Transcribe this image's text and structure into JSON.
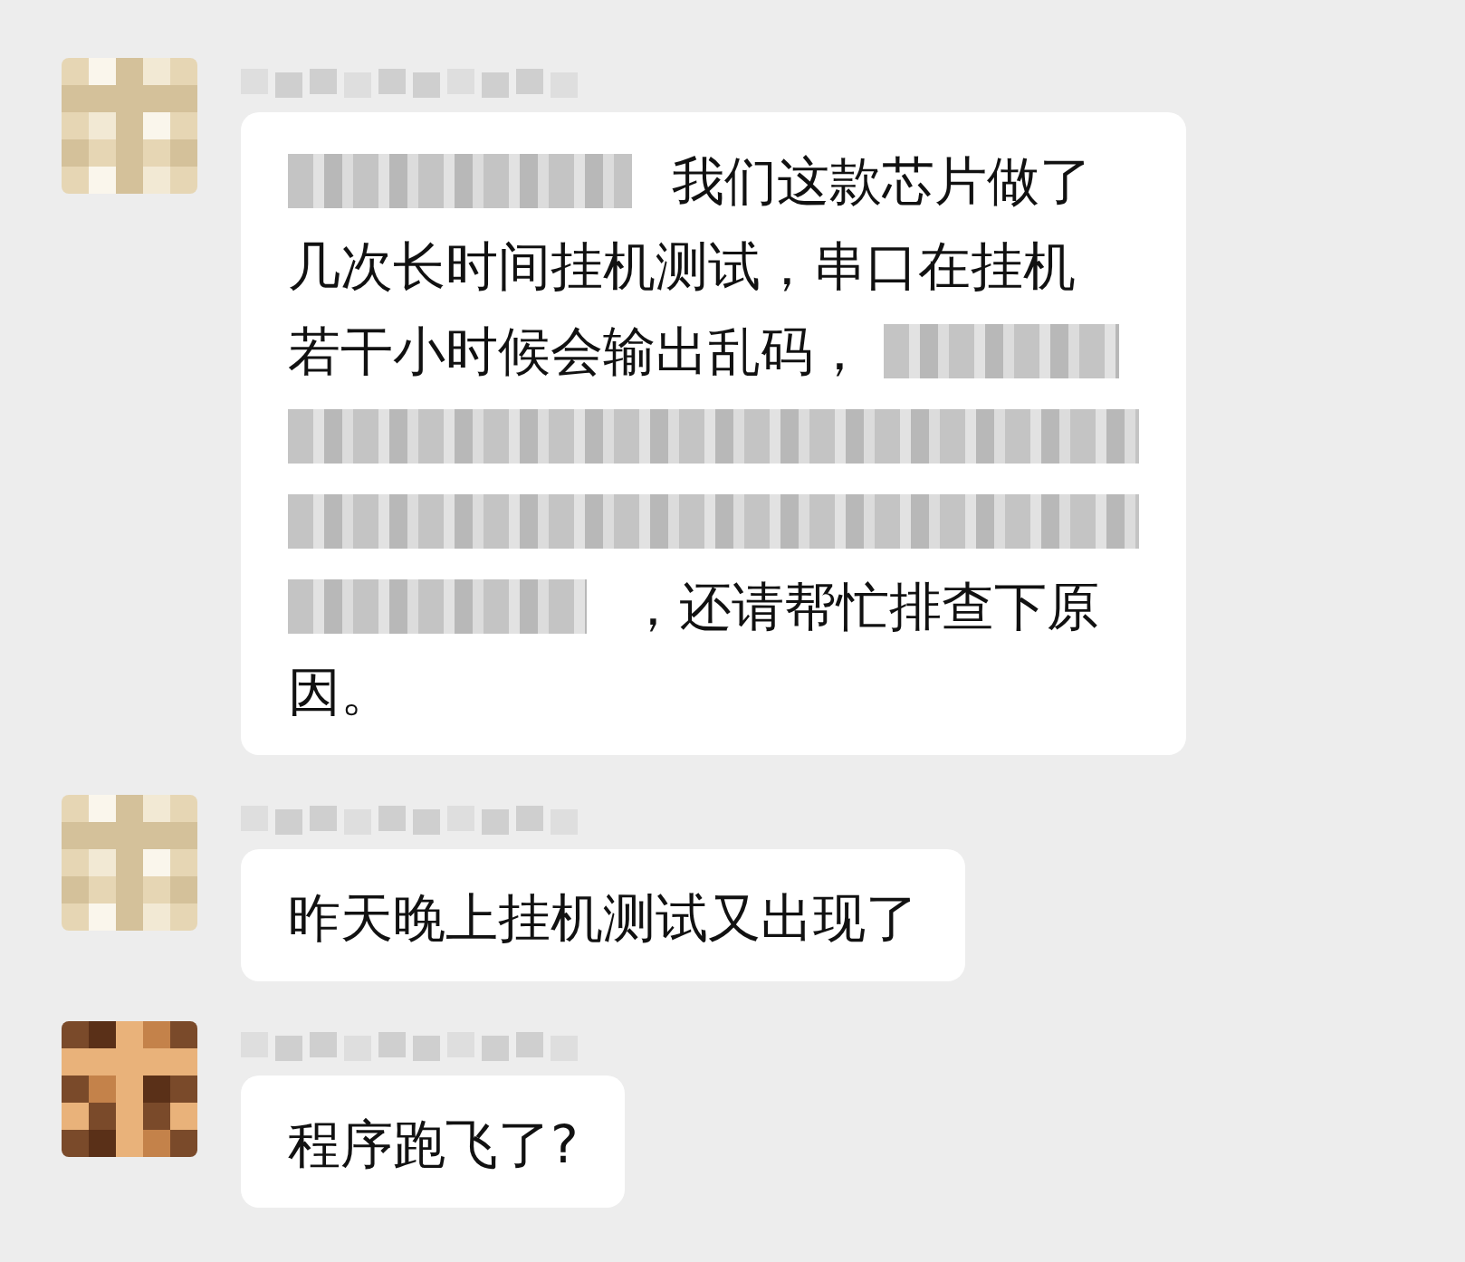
{
  "messages": [
    {
      "lines": [
        [
          {
            "kind": "redacted"
          },
          {
            "kind": "text",
            "text": "我们这款芯片做了"
          }
        ],
        [
          {
            "kind": "text",
            "text": "几次长时间挂机测试，串口在挂机"
          }
        ],
        [
          {
            "kind": "text",
            "text": "若干小时候会输出乱码，"
          },
          {
            "kind": "redacted"
          }
        ],
        [
          {
            "kind": "redacted"
          }
        ],
        [
          {
            "kind": "redacted"
          }
        ],
        [
          {
            "kind": "redacted"
          },
          {
            "kind": "text",
            "text": "，还请帮忙排查下原"
          }
        ],
        [
          {
            "kind": "text",
            "text": "因。"
          }
        ]
      ]
    },
    {
      "lines": [
        [
          {
            "kind": "text",
            "text": "昨天晚上挂机测试又出现了"
          }
        ]
      ]
    },
    {
      "lines": [
        [
          {
            "kind": "text",
            "text": "程序跑飞了?"
          }
        ]
      ]
    }
  ]
}
